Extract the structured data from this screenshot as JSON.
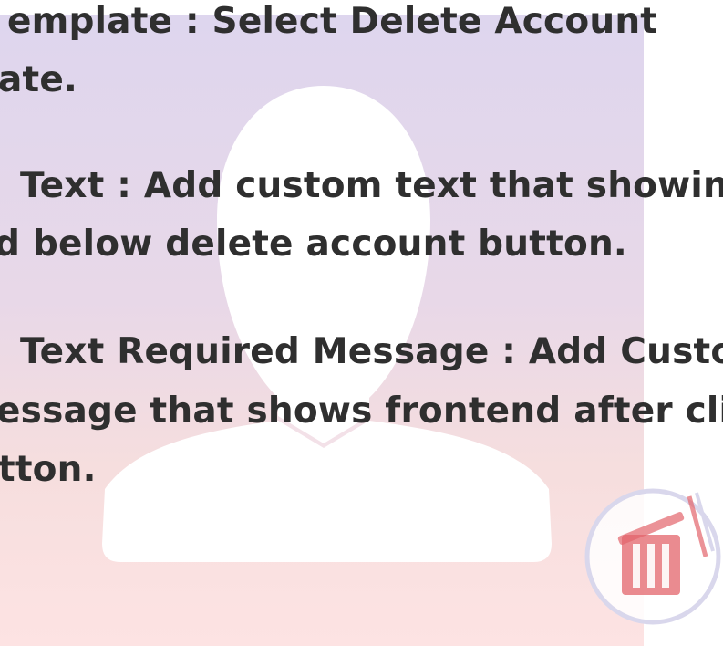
{
  "settings_help": {
    "lines": [
      "emplate : Select Delete Account",
      "ate.",
      "Text : Add custom text that showing",
      "d below delete account button.",
      "Text Required Message : Add Custo",
      "essage that shows frontend after clic",
      "tton."
    ]
  },
  "icons": {
    "background": "user-silhouette-icon",
    "logo": "trash-can-icon"
  },
  "colors": {
    "text": "#2f2f2f",
    "avatar_top": "#ded6ee",
    "avatar_bottom": "#fde3e3",
    "logo_accent": "#e3646b",
    "logo_ring": "#d9d7ec"
  }
}
